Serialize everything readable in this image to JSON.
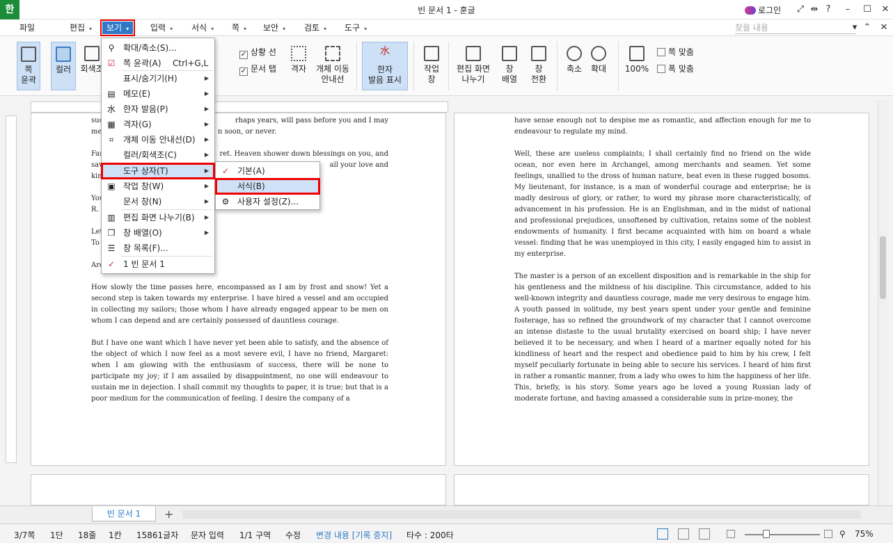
{
  "titlebar": {
    "app_icon": "한",
    "title": "빈 문서 1 - 훈글",
    "login": "로그인",
    "icons": [
      "fullscreen-icon",
      "split-icon",
      "help-icon",
      "minimize-icon",
      "maximize-icon",
      "close-icon"
    ]
  },
  "menubar": {
    "items": [
      "파일",
      "편집",
      "보기",
      "입력",
      "서식",
      "쪽",
      "보안",
      "검토",
      "도구"
    ],
    "search_placeholder": "찾을 내용"
  },
  "ribbon": {
    "page_outline": "쪽\n윤곽",
    "color": "컬러",
    "grayscale": "회색조",
    "status_line": "상황 선",
    "doc_tab": "문서 탭",
    "grid": "격자",
    "object_guide": "개체 이동\n안내선",
    "hanja_pron": "한자\n발음 표시",
    "work_window": "작업\n창",
    "split_view": "편집 화면\n나누기",
    "arrange": "창\n배열",
    "switch": "창\n전환",
    "zoom_out": "축소",
    "zoom_in": "확대",
    "percent100": "100%",
    "fit_page": "쪽 맞춤",
    "fit_width": "폭 맞춤"
  },
  "view_menu": [
    {
      "label": "확대/축소(S)...",
      "icon": "magnifier-icon",
      "sub": false,
      "shortcut": ""
    },
    {
      "label": "쪽 윤곽(A)",
      "icon": "checkbox-checked-icon",
      "sub": false,
      "shortcut": "Ctrl+G,L"
    },
    {
      "label": "표시/숨기기(H)",
      "icon": "",
      "sub": true,
      "shortcut": ""
    },
    {
      "label": "메모(E)",
      "icon": "memo-icon",
      "sub": true,
      "shortcut": ""
    },
    {
      "label": "한자 발음(P)",
      "icon": "hanja-icon",
      "sub": true,
      "shortcut": ""
    },
    {
      "label": "격자(G)",
      "icon": "grid-icon",
      "sub": true,
      "shortcut": ""
    },
    {
      "label": "개체 이동 안내선(D)",
      "icon": "guide-icon",
      "sub": true,
      "shortcut": ""
    },
    {
      "label": "컬러/회색조(C)",
      "icon": "",
      "sub": true,
      "shortcut": ""
    },
    {
      "label": "도구 상자(T)",
      "icon": "",
      "sub": true,
      "shortcut": ""
    },
    {
      "label": "작업 창(W)",
      "icon": "window-icon",
      "sub": true,
      "shortcut": ""
    },
    {
      "label": "문서 창(N)",
      "icon": "",
      "sub": true,
      "shortcut": ""
    },
    {
      "label": "편집 화면 나누기(B)",
      "icon": "split-icon",
      "sub": true,
      "shortcut": ""
    },
    {
      "label": "창 배열(O)",
      "icon": "cascade-icon",
      "sub": true,
      "shortcut": ""
    },
    {
      "label": "창 목록(F)...",
      "icon": "list-icon",
      "sub": false,
      "shortcut": ""
    },
    {
      "label": "1 빈 문서 1",
      "icon": "check-icon",
      "sub": false,
      "shortcut": ""
    }
  ],
  "toolbox_submenu": [
    {
      "label": "기본(A)",
      "icon": "check-icon"
    },
    {
      "label": "서식(B)",
      "icon": ""
    },
    {
      "label": "사용자 설정(Z)...",
      "icon": "user-settings-icon"
    }
  ],
  "page_left": {
    "p1a": "suc",
    "p1b": "rhaps years, will pass before you and I may",
    "p1c": "me",
    "p1d": "n soon, or never.",
    "p2a": "Far",
    "p2b": "ret. Heaven shower down blessings on you, and",
    "p2c": "sav",
    "p2d": "all your love and",
    "p2e": "kin",
    "p3a": "You",
    "p3b": "R.",
    "p4a": "Let",
    "p4b": "To",
    "p5": "Arc",
    "p6": "How slowly the time passes here, encompassed as I am by frost and snow! Yet a second step is taken towards my enterprise. I have hired a vessel and am occupied in collecting my sailors; those whom I have already engaged appear to be men on whom I can depend and are certainly possessed of dauntless courage.",
    "p7": "But I have one want which I have never yet been able to satisfy, and the absence of the object of which I now feel as a most severe evil, I have no friend, Margaret: when I am glowing with the enthusiasm of success, there will be none to participate my joy; if I am assailed by disappointment, no one will endeavour to sustain me in dejection. I shall commit my thoughts to paper, it is true; but that is a poor medium for the communication of feeling. I desire the company of a"
  },
  "page_right": {
    "p1": "have sense enough not to despise me as romantic, and affection enough for me to endeavour to regulate my mind.",
    "p2": "Well, these are useless complaints; I shall certainly find no friend on the wide ocean, nor even here in Archangel, among merchants and seamen. Yet some feelings, unallied to the dross of human nature, beat even in these rugged bosoms. My lieutenant, for instance, is a man of wonderful courage and enterprise; he is madly desirous of glory, or rather, to word my phrase more characteristically, of advancement in his profession. He is an Englishman, and in the midst of national and professional prejudices, unsoftened by cultivation, retains some of the noblest endowments of humanity. I first became acquainted with him on board a whale vessel: finding that he was unemployed in this city, I easily engaged him to assist in my enterprise.",
    "p3": "The master is a person of an excellent disposition and is remarkable in the ship for his gentleness and the mildness of his discipline. This circumstance, added to his well-known integrity and dauntless courage, made me very desirous to engage him. A youth passed in solitude, my best years spent under your gentle and feminine fosterage, has so refined the groundwork of my character that I cannot overcome an intense distaste to the usual brutality exercised on board ship; I have never believed it to be necessary, and when I heard of a mariner equally noted for his kindliness of heart and the respect and obedience paid to him by his crew, I felt myself peculiarly fortunate in being able to secure his services. I heard of him first in rather a romantic manner, from a lady who owes to him the happiness of her life. This, briefly, is his story. Some years ago he loved a young Russian lady of moderate fortune, and having amassed a considerable sum in prize-money, the"
  },
  "tabs": {
    "doc": "빈 문서 1",
    "add": "+"
  },
  "statusbar": {
    "page": "3/7쪽",
    "section": "1단",
    "line": "18줄",
    "col": "1칸",
    "chars": "15861글자",
    "mode": "문자 입력",
    "area": "1/1 구역",
    "edit": "수정",
    "track": "변경 내용 [기록 중지]",
    "typing": "타수 : 200타",
    "zoom": "75%"
  },
  "colors": {
    "accent": "#2f78c8",
    "highlight": "#e00000",
    "check": "#c0282d",
    "app_green": "#1d8c3a"
  }
}
